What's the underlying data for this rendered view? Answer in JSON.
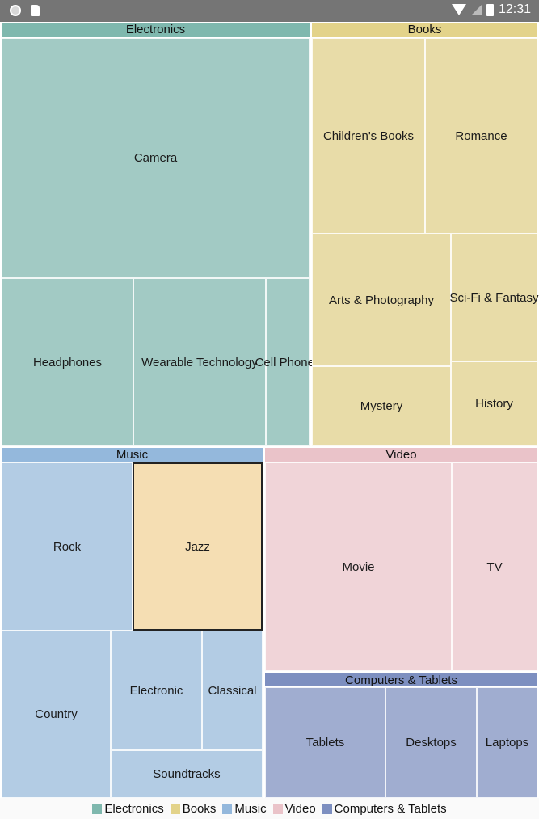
{
  "status_bar": {
    "time": "12:31",
    "icons": [
      "record-icon",
      "sd-card-icon",
      "wifi-icon",
      "cell-signal-icon",
      "battery-charging-icon"
    ]
  },
  "chart_data": {
    "type": "treemap",
    "title": "",
    "legend_position": "bottom",
    "groups": [
      {
        "name": "Electronics",
        "header_color": "#7fb8ae",
        "fill_color": "#a2cac4",
        "items": [
          {
            "name": "Camera",
            "value": 113
          },
          {
            "name": "Headphones",
            "value": 34
          },
          {
            "name": "Wearable Technology",
            "value": 34
          },
          {
            "name": "Cell Phones",
            "value": 11
          }
        ]
      },
      {
        "name": "Books",
        "header_color": "#e3d38a",
        "fill_color": "#e8dca8",
        "items": [
          {
            "name": "Children's Books",
            "value": 34
          },
          {
            "name": "Romance",
            "value": 34
          },
          {
            "name": "Arts & Photography",
            "value": 28
          },
          {
            "name": "Sci-Fi & Fantasy",
            "value": 17
          },
          {
            "name": "History",
            "value": 17
          },
          {
            "name": "Mystery",
            "value": 11
          }
        ]
      },
      {
        "name": "Music",
        "header_color": "#94b8dc",
        "fill_color": "#b3cce4",
        "items": [
          {
            "name": "Rock",
            "value": 34
          },
          {
            "name": "Jazz",
            "value": 33,
            "selected": true,
            "selected_color": "#f5deb3"
          },
          {
            "name": "Country",
            "value": 28
          },
          {
            "name": "Electronic",
            "value": 17
          },
          {
            "name": "Classical",
            "value": 11
          },
          {
            "name": "Soundtracks",
            "value": 11
          }
        ]
      },
      {
        "name": "Video",
        "header_color": "#eac3c9",
        "fill_color": "#f0d4d8",
        "items": [
          {
            "name": "Movie",
            "value": 60
          },
          {
            "name": "TV",
            "value": 27
          }
        ]
      },
      {
        "name": "Computers & Tablets",
        "header_color": "#7d8fc0",
        "fill_color": "#a0add0",
        "items": [
          {
            "name": "Tablets",
            "value": 20
          },
          {
            "name": "Desktops",
            "value": 15
          },
          {
            "name": "Laptops",
            "value": 10
          }
        ]
      }
    ]
  }
}
